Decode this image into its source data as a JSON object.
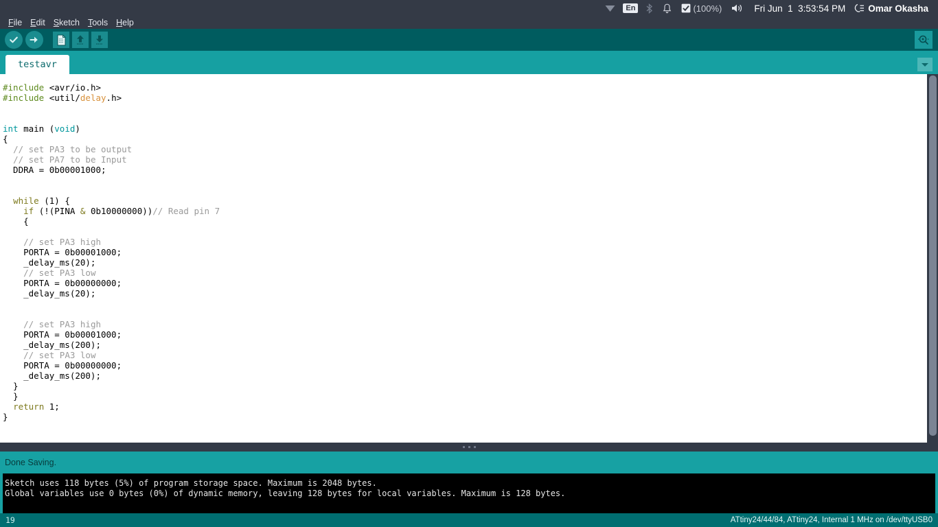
{
  "system_bar": {
    "tray_icons": [
      {
        "name": "wifi-icon",
        "label": "wifi"
      },
      {
        "name": "keyboard-layout-icon",
        "label": "En"
      },
      {
        "name": "bluetooth-icon",
        "label": "bluetooth"
      },
      {
        "name": "notifications-bell-icon",
        "label": "bell"
      },
      {
        "name": "battery-icon",
        "label": "battery"
      }
    ],
    "battery_percent": "(100%)",
    "volume_icon": "volume-icon",
    "clock": "Fri Jun  1  3:53:54 PM",
    "session_icon": "session-indicator-icon",
    "user_name": "Omar Okasha"
  },
  "menu_bar": {
    "items": [
      {
        "name": "menu-file",
        "mnemonic": "F",
        "rest": "ile"
      },
      {
        "name": "menu-edit",
        "mnemonic": "E",
        "rest": "dit"
      },
      {
        "name": "menu-sketch",
        "mnemonic": "S",
        "rest": "ketch"
      },
      {
        "name": "menu-tools",
        "mnemonic": "T",
        "rest": "ools"
      },
      {
        "name": "menu-help",
        "mnemonic": "H",
        "rest": "elp"
      }
    ]
  },
  "toolbar": {
    "verify_label": "Verify",
    "upload_label": "Upload",
    "new_label": "New",
    "open_label": "Open",
    "save_label": "Save",
    "serial_monitor_label": "Serial Monitor"
  },
  "tabs": {
    "active": "testavr",
    "menu_button_label": "Tab menu"
  },
  "editor": {
    "filename": "testavr",
    "lines": [
      [
        {
          "t": "#include",
          "c": "pre"
        },
        {
          "t": " <avr/io.h>",
          "c": "plain"
        }
      ],
      [
        {
          "t": "#include",
          "c": "pre"
        },
        {
          "t": " <util/",
          "c": "plain"
        },
        {
          "t": "delay",
          "c": "lib"
        },
        {
          "t": ".h>",
          "c": "plain"
        }
      ],
      [],
      [],
      [
        {
          "t": "int",
          "c": "type"
        },
        {
          "t": " main (",
          "c": "plain"
        },
        {
          "t": "void",
          "c": "type"
        },
        {
          "t": ")",
          "c": "plain"
        }
      ],
      [
        {
          "t": "{",
          "c": "plain"
        }
      ],
      [
        {
          "t": "  ",
          "c": "plain"
        },
        {
          "t": "// set PA3 to be output",
          "c": "cmt"
        }
      ],
      [
        {
          "t": "  ",
          "c": "plain"
        },
        {
          "t": "// set PA7 to be Input",
          "c": "cmt"
        }
      ],
      [
        {
          "t": "  DDRA = 0b00001000;",
          "c": "plain"
        }
      ],
      [],
      [],
      [
        {
          "t": "  ",
          "c": "plain"
        },
        {
          "t": "while",
          "c": "kw"
        },
        {
          "t": " (1) {",
          "c": "plain"
        }
      ],
      [
        {
          "t": "    ",
          "c": "plain"
        },
        {
          "t": "if",
          "c": "kw"
        },
        {
          "t": " (!(PINA ",
          "c": "plain"
        },
        {
          "t": "&",
          "c": "op"
        },
        {
          "t": " 0b10000000))",
          "c": "plain"
        },
        {
          "t": "// Read pin 7",
          "c": "cmt"
        }
      ],
      [
        {
          "t": "    {",
          "c": "plain"
        }
      ],
      [],
      [
        {
          "t": "    ",
          "c": "plain"
        },
        {
          "t": "// set PA3 high",
          "c": "cmt"
        }
      ],
      [
        {
          "t": "    PORTA = 0b00001000;",
          "c": "plain"
        }
      ],
      [
        {
          "t": "    _delay_ms(20);",
          "c": "plain"
        }
      ],
      [
        {
          "t": "    ",
          "c": "plain"
        },
        {
          "t": "// set PA3 low",
          "c": "cmt"
        }
      ],
      [
        {
          "t": "    PORTA = 0b00000000;",
          "c": "plain"
        }
      ],
      [
        {
          "t": "    _delay_ms(20);",
          "c": "plain"
        }
      ],
      [],
      [],
      [
        {
          "t": "    ",
          "c": "plain"
        },
        {
          "t": "// set PA3 high",
          "c": "cmt"
        }
      ],
      [
        {
          "t": "    PORTA = 0b00001000;",
          "c": "plain"
        }
      ],
      [
        {
          "t": "    _delay_ms(200);",
          "c": "plain"
        }
      ],
      [
        {
          "t": "    ",
          "c": "plain"
        },
        {
          "t": "// set PA3 low",
          "c": "cmt"
        }
      ],
      [
        {
          "t": "    PORTA = 0b00000000;",
          "c": "plain"
        }
      ],
      [
        {
          "t": "    _delay_ms(200);",
          "c": "plain"
        }
      ],
      [
        {
          "t": "  }",
          "c": "plain"
        }
      ],
      [
        {
          "t": "  }",
          "c": "plain"
        }
      ],
      [
        {
          "t": "  ",
          "c": "plain"
        },
        {
          "t": "return",
          "c": "kw"
        },
        {
          "t": " 1;",
          "c": "plain"
        }
      ],
      [
        {
          "t": "}",
          "c": "plain"
        }
      ]
    ]
  },
  "status": {
    "message": "Done Saving."
  },
  "console": {
    "lines": [
      "Sketch uses 118 bytes (5%) of program storage space. Maximum is 2048 bytes.",
      "Global variables use 0 bytes (0%) of dynamic memory, leaving 128 bytes for local variables. Maximum is 128 bytes."
    ]
  },
  "footer": {
    "line_number": "19",
    "board_info": "ATtiny24/44/84, ATtiny24, Internal 1 MHz on /dev/ttyUSB0"
  },
  "colors": {
    "panel_dark": "#343a46",
    "toolbar_dark_teal": "#005c5f",
    "tab_teal": "#16a0a2",
    "status_teal": "#17a1a3",
    "footer_teal": "#006e71",
    "console_black": "#000000",
    "keyword": "#7e7a1f",
    "type": "#00979c",
    "preprocessor": "#5e8a1e",
    "library": "#d8913b",
    "comment": "#9a9a9a"
  }
}
